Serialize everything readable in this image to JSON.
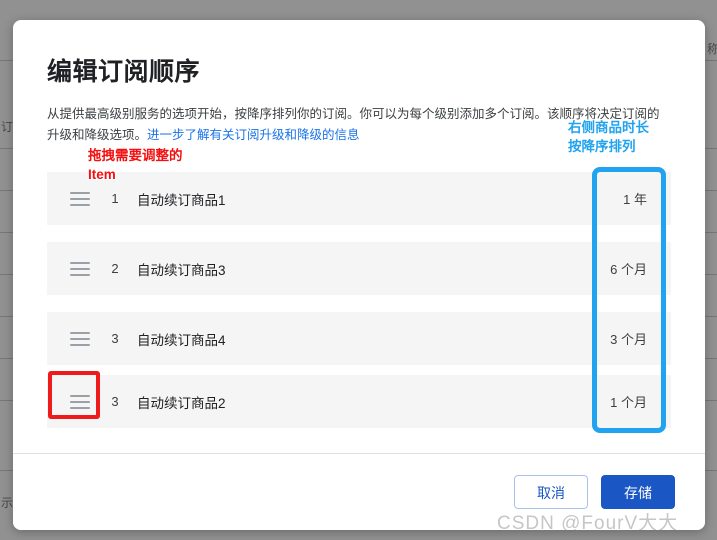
{
  "background": {
    "partial_char_left": "订",
    "partial_char_left_lower": "示",
    "partial_char_right": "称"
  },
  "modal": {
    "title": "编辑订阅顺序",
    "description_part1": "从提供最高级别服务的选项开始，按降序排列你的订阅。你可以为每个级别添加多个订阅。该顺序将决定订阅的升级和降级选项。",
    "description_link": "进一步了解有关订阅升级和降级的信息",
    "rows": [
      {
        "index": "1",
        "name": "自动续订商品1",
        "duration": "1 年"
      },
      {
        "index": "2",
        "name": "自动续订商品3",
        "duration": "6 个月"
      },
      {
        "index": "3",
        "name": "自动续订商品4",
        "duration": "3 个月"
      },
      {
        "index": "3",
        "name": "自动续订商品2",
        "duration": "1 个月"
      }
    ],
    "footer": {
      "cancel_label": "取消",
      "save_label": "存储"
    }
  },
  "annotations": {
    "red_note": "拖拽需要调整的\nItem",
    "blue_note": "右侧商品时长\n按降序排列",
    "red_color": "#ef1b1b",
    "blue_color": "#21a3ef"
  },
  "watermark": "CSDN @FourV大大"
}
